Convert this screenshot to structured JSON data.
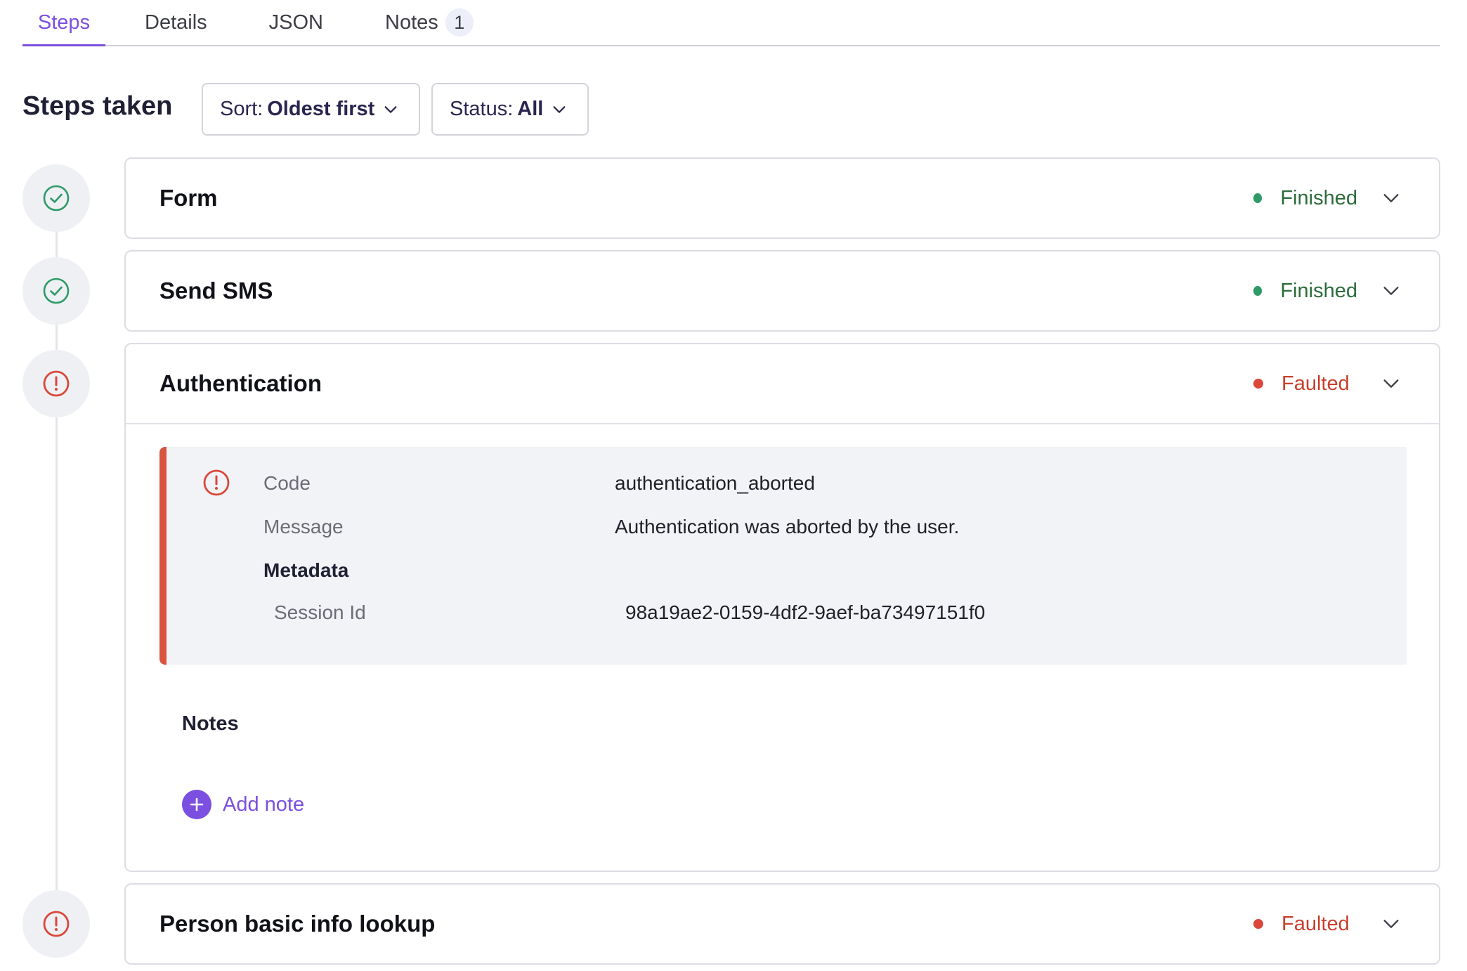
{
  "tabs": [
    {
      "label": "Steps"
    },
    {
      "label": "Details"
    },
    {
      "label": "JSON"
    },
    {
      "label": "Notes",
      "badge": "1"
    }
  ],
  "header": {
    "title": "Steps taken",
    "sort": {
      "key": "Sort:",
      "value": "Oldest first"
    },
    "status_filter": {
      "key": "Status:",
      "value": "All"
    }
  },
  "steps": [
    {
      "name": "Form",
      "status": "Finished",
      "icon": "check-circle-icon"
    },
    {
      "name": "Send SMS",
      "status": "Finished",
      "icon": "check-circle-icon"
    },
    {
      "name": "Authentication",
      "status": "Faulted",
      "icon": "alert-circle-icon",
      "error": {
        "code_label": "Code",
        "code": "authentication_aborted",
        "message_label": "Message",
        "message": "Authentication was aborted by the user.",
        "metadata_label": "Metadata",
        "session_label": "Session Id",
        "session_id": "98a19ae2-0159-4df2-9aef-ba73497151f0"
      },
      "notes_title": "Notes",
      "add_note_label": "Add note"
    },
    {
      "name": "Person basic info lookup",
      "status": "Faulted",
      "icon": "alert-circle-icon"
    }
  ],
  "colors": {
    "accent": "#7b4fe0",
    "finished": "#2e9a68",
    "faulted": "#d9483a"
  }
}
